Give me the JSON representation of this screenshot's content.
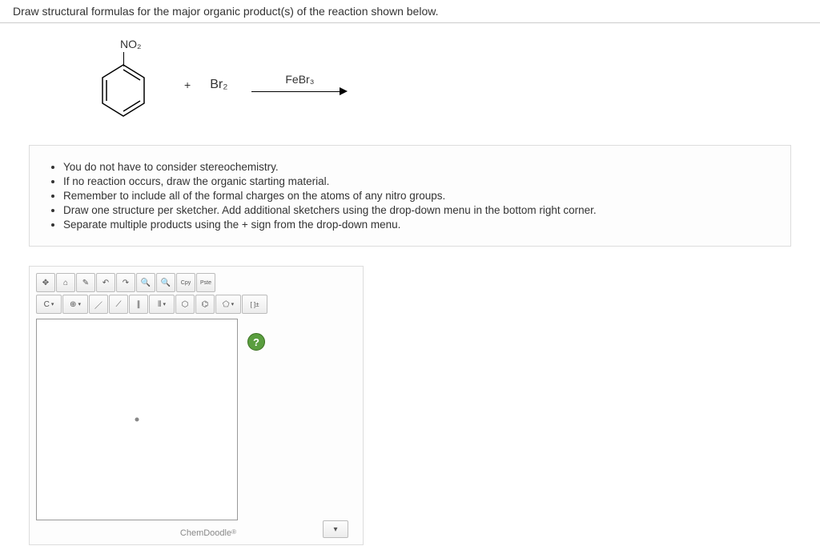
{
  "question": "Draw structural formulas for the major organic product(s) of the reaction shown below.",
  "reaction": {
    "substituent": "NO₂",
    "plus": "+",
    "reagent": "Br₂",
    "catalyst": "FeBr₃"
  },
  "instructions": [
    "You do not have to consider stereochemistry.",
    "If no reaction occurs, draw the organic starting material.",
    "Remember to include all of the formal charges on the atoms of any nitro groups.",
    "Draw one structure per sketcher. Add additional sketchers using the drop-down menu in the bottom right corner.",
    "Separate multiple products using the + sign from the drop-down menu."
  ],
  "sketcher": {
    "element_btn": "C",
    "charge_btn": "⊕",
    "copy_btn": "Cpy",
    "paste_btn": "Pste",
    "charges_btn": "[ ]±",
    "brand": "ChemDoodle",
    "dropdown": "▾",
    "help": "?"
  }
}
